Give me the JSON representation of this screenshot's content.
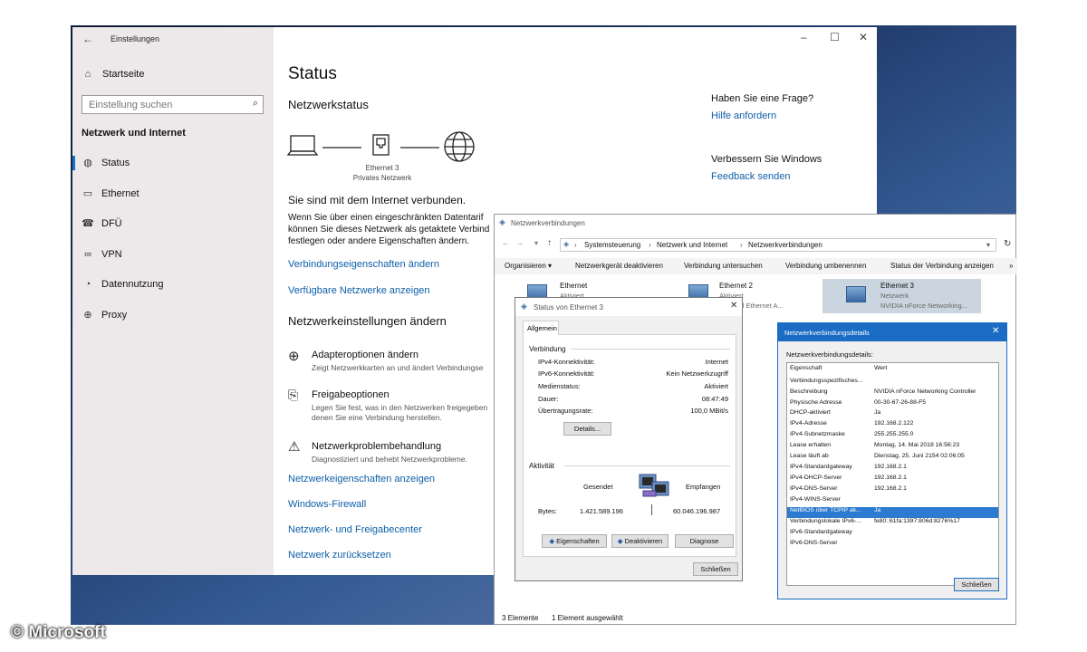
{
  "watermark": "© Microsoft",
  "settings": {
    "title": "Einstellungen",
    "home": "Startseite",
    "search_placeholder": "Einstellung suchen",
    "section": "Netzwerk und Internet",
    "nav": [
      {
        "label": "Status",
        "icon": "globe-status-icon"
      },
      {
        "label": "Ethernet",
        "icon": "ethernet-icon"
      },
      {
        "label": "DFÜ",
        "icon": "dialup-icon"
      },
      {
        "label": "VPN",
        "icon": "vpn-icon"
      },
      {
        "label": "Datennutzung",
        "icon": "data-usage-icon"
      },
      {
        "label": "Proxy",
        "icon": "globe-icon"
      }
    ],
    "page_title": "Status",
    "netstatus_heading": "Netzwerkstatus",
    "adapter_name": "Ethernet 3",
    "network_type": "Privates Netzwerk",
    "connected_heading": "Sie sind mit dem Internet verbunden.",
    "connected_text": [
      "Wenn Sie über einen eingeschränkten Datentarif",
      "können Sie dieses Netzwerk als getaktete Verbind",
      "festlegen oder andere Eigenschaften ändern."
    ],
    "link_change_props": "Verbindungseigenschaften ändern",
    "link_show_networks": "Verfügbare Netzwerke anzeigen",
    "change_heading": "Netzwerkeinstellungen ändern",
    "options": [
      {
        "title": "Adapteroptionen ändern",
        "desc1": "Zeigt Netzwerkkarten an und ändert Verbindungse",
        "desc2": ""
      },
      {
        "title": "Freigabeoptionen",
        "desc1": "Legen Sie fest, was in den Netzwerken freigegeben",
        "desc2": "denen Sie eine Verbindung herstellen."
      },
      {
        "title": "Netzwerkproblembehandlung",
        "desc1": "Diagnostiziert und behebt Netzwerkprobleme.",
        "desc2": ""
      }
    ],
    "bottom_links": [
      "Netzwerkeigenschaften anzeigen",
      "Windows-Firewall",
      "Netzwerk- und Freigabecenter",
      "Netzwerk zurücksetzen"
    ],
    "question_heading": "Haben Sie eine Frage?",
    "help_link": "Hilfe anfordern",
    "improve_heading": "Verbessern Sie Windows",
    "feedback_link": "Feedback senden"
  },
  "netconn": {
    "title": "Netzwerkverbindungen",
    "breadcrumb": [
      "Systemsteuerung",
      "Netzwerk und Internet",
      "Netzwerkverbindungen"
    ],
    "commands": [
      "Organisieren ▾",
      "Netzwerkgerät deaktivieren",
      "Verbindung untersuchen",
      "Verbindung umbenennen",
      "Status der Verbindung anzeigen",
      "»"
    ],
    "adapters": [
      {
        "name": "Ethernet",
        "status": "Aktiviert",
        "device": ""
      },
      {
        "name": "Ethernet 2",
        "status": "Aktiviert",
        "device": "e Virtual Ethernet A..."
      },
      {
        "name": "Ethernet 3",
        "status": "Netzwerk",
        "device": "NVIDIA nForce Networking..."
      }
    ],
    "statusbar": [
      "3 Elemente",
      "1 Element ausgewählt"
    ]
  },
  "status_dialog": {
    "title": "Status von Ethernet 3",
    "tab": "Allgemein",
    "connection_group": "Verbindung",
    "rows": [
      {
        "label": "IPv4-Konnektivität:",
        "value": "Internet"
      },
      {
        "label": "IPv6-Konnektivität:",
        "value": "Kein Netzwerkzugriff"
      },
      {
        "label": "Medienstatus:",
        "value": "Aktiviert"
      },
      {
        "label": "Dauer:",
        "value": "08:47:49"
      },
      {
        "label": "Übertragungsrate:",
        "value": "100,0 MBit/s"
      }
    ],
    "details_button": "Details...",
    "activity_group": "Aktivität",
    "sent_label": "Gesendet",
    "received_label": "Empfangen",
    "bytes_label": "Bytes:",
    "bytes_sent": "1.421.589.196",
    "bytes_received": "60.046.196.987",
    "buttons": [
      "Eigenschaften",
      "Deaktivieren",
      "Diagnose"
    ],
    "close_button": "Schließen"
  },
  "details_dialog": {
    "title": "Netzwerkverbindungsdetails",
    "label": "Netzwerkverbindungsdetails:",
    "col_property": "Eigenschaft",
    "col_value": "Wert",
    "rows": [
      {
        "k": "Verbindungsspezifisches...",
        "v": ""
      },
      {
        "k": "Beschreibung",
        "v": "NVIDIA nForce Networking Controller"
      },
      {
        "k": "Physische Adresse",
        "v": "00-30-67-26-88-F5"
      },
      {
        "k": "DHCP-aktiviert",
        "v": "Ja"
      },
      {
        "k": "IPv4-Adresse",
        "v": "192.168.2.122"
      },
      {
        "k": "IPv4-Subnetzmaske",
        "v": "255.255.255.0"
      },
      {
        "k": "Lease erhalten",
        "v": "Montag, 14. Mai 2018 16:56:23"
      },
      {
        "k": "Lease läuft ab",
        "v": "Dienstag, 25. Juni 2154 02:06:05"
      },
      {
        "k": "IPv4-Standardgateway",
        "v": "192.168.2.1"
      },
      {
        "k": "IPv4-DHCP-Server",
        "v": "192.168.2.1"
      },
      {
        "k": "IPv4-DNS-Server",
        "v": "192.168.2.1"
      },
      {
        "k": "IPv4-WINS-Server",
        "v": ""
      },
      {
        "k": "NetBIOS über TCPIP ak...",
        "v": "Ja"
      },
      {
        "k": "Verbindungslokale IPv6-...",
        "v": "fe80::61fa:1397:806d:8276%17"
      },
      {
        "k": "IPv6-Standardgateway",
        "v": ""
      },
      {
        "k": "IPv6-DNS-Server",
        "v": ""
      }
    ],
    "selected_row": 12,
    "close_button": "Schließen"
  }
}
